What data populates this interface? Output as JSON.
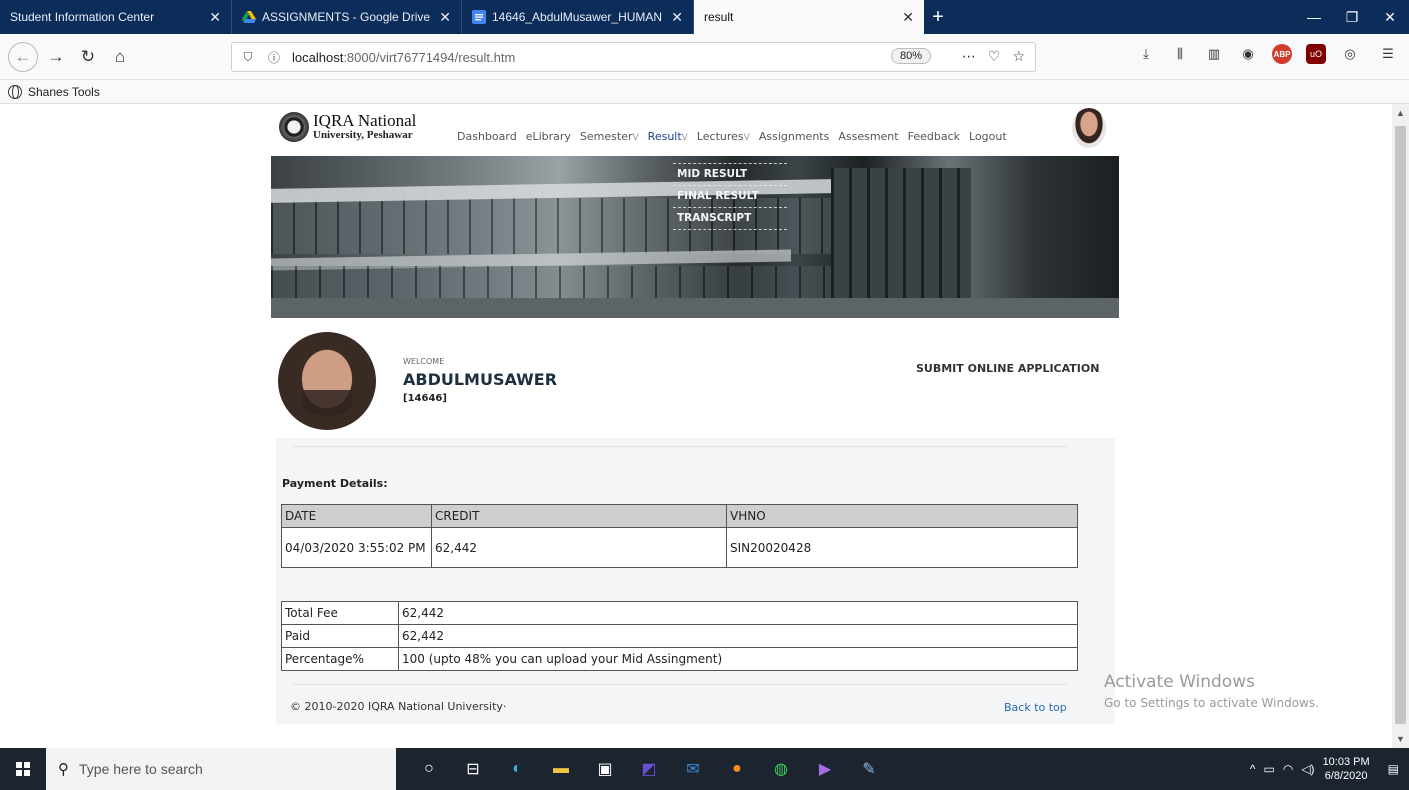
{
  "browser": {
    "tabs": [
      {
        "title": "Student Information Center",
        "active": false
      },
      {
        "title": "ASSIGNMENTS - Google Drive",
        "active": false
      },
      {
        "title": "14646_AbdulMusawer_HUMAN",
        "active": false
      },
      {
        "title": "result",
        "active": true
      }
    ],
    "url_host": "localhost",
    "url_rest": ":8000/virt76771494/result.htm",
    "zoom": "80%",
    "bookmark": "Shanes Tools"
  },
  "site": {
    "logo_line1": "IQRA National",
    "logo_line2": "University, Peshawar",
    "menu": [
      {
        "label": "Dashboard",
        "caret": ""
      },
      {
        "label": "eLibrary",
        "caret": ""
      },
      {
        "label": "Semester",
        "caret": "V"
      },
      {
        "label": "Result",
        "caret": "V",
        "active": true
      },
      {
        "label": "Lectures",
        "caret": "V"
      },
      {
        "label": "Assignments",
        "caret": ""
      },
      {
        "label": "Assesment",
        "caret": ""
      },
      {
        "label": "Feedback",
        "caret": ""
      },
      {
        "label": "Logout",
        "caret": ""
      }
    ],
    "result_dropdown": [
      "MID RESULT",
      "FINAL RESULT",
      "TRANSCRIPT"
    ]
  },
  "profile": {
    "welcome": "WELCOME",
    "name": "ABDULMUSAWER",
    "id": "[14646]",
    "submit_link": "SUBMIT ONLINE APPLICATION"
  },
  "payment": {
    "title": "Payment Details:",
    "headers": [
      "DATE",
      "CREDIT",
      "VHNO"
    ],
    "rows": [
      [
        "04/03/2020 3:55:02 PM",
        "62,442",
        "SIN20020428"
      ]
    ]
  },
  "fees": {
    "rows": [
      [
        "Total Fee",
        "62,442"
      ],
      [
        "Paid",
        "62,442"
      ],
      [
        "Percentage%",
        "100 (upto 48% you can upload your Mid Assingment)"
      ]
    ]
  },
  "footer": {
    "copyright": "© 2010-2020 IQRA National University·",
    "back_to_top": "Back to top"
  },
  "watermark": {
    "line1": "Activate Windows",
    "line2": "Go to Settings to activate Windows."
  },
  "taskbar": {
    "search_placeholder": "Type here to search",
    "time": "10:03 PM",
    "date": "6/8/2020"
  }
}
